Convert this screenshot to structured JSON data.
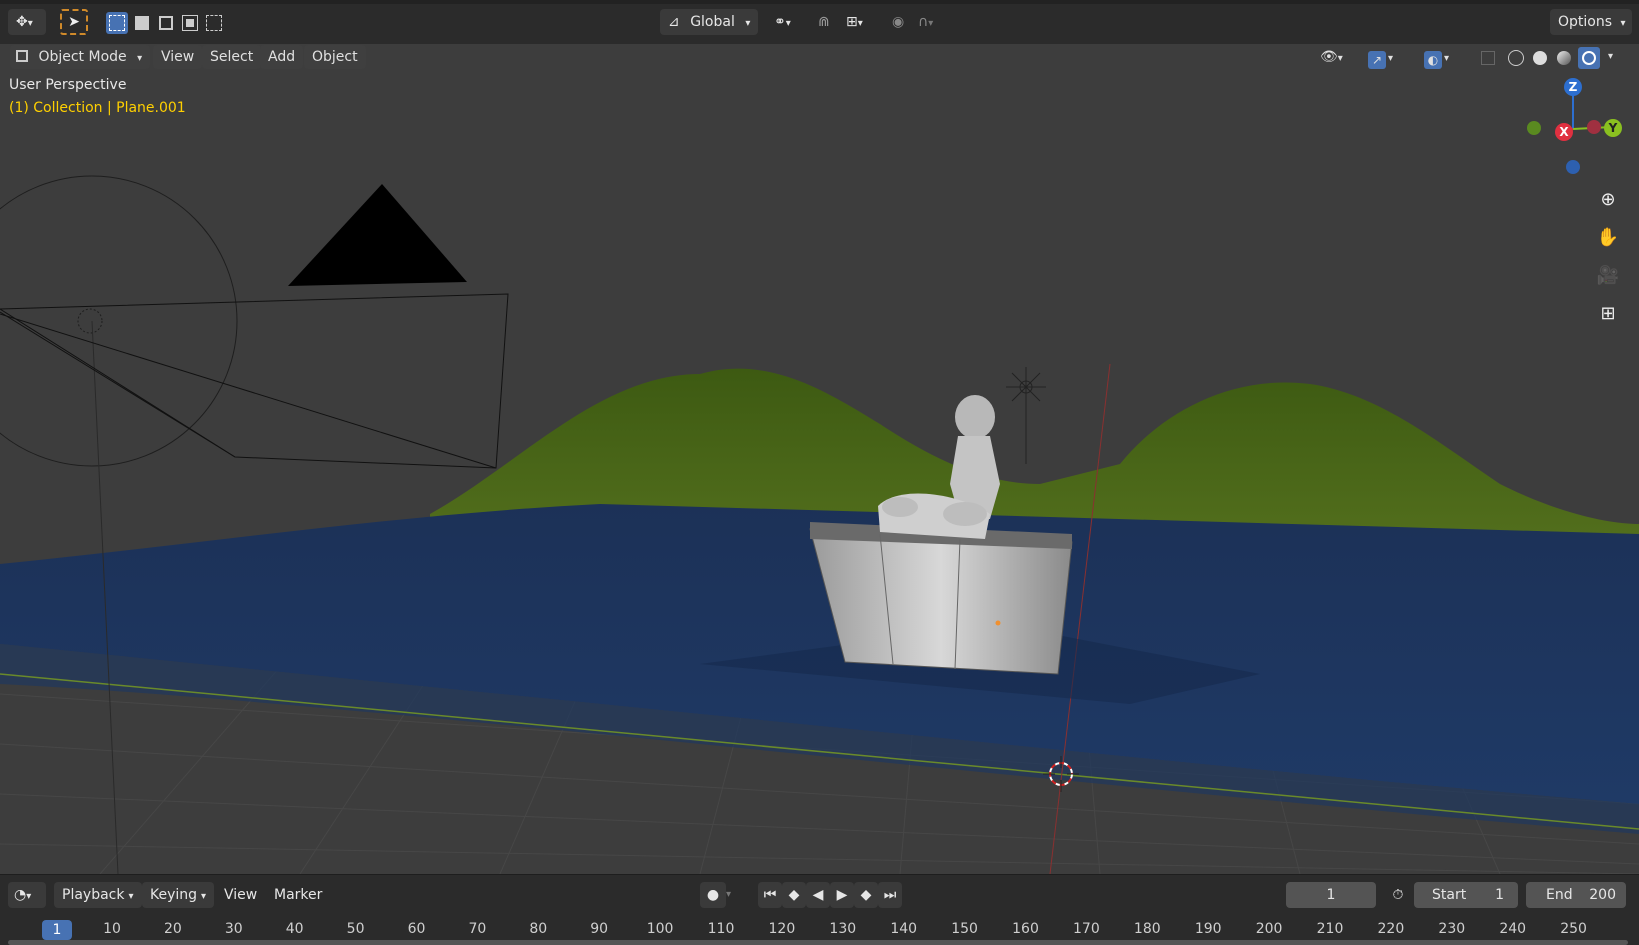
{
  "top_toolbar": {
    "orientation_label": "Global",
    "options_label": "Options"
  },
  "header": {
    "mode_label": "Object Mode",
    "menus": [
      "View",
      "Select",
      "Add",
      "Object"
    ]
  },
  "viewport": {
    "view_name": "User Perspective",
    "collection_info": "(1) Collection | Plane.001",
    "gizmo": {
      "z": "Z",
      "x": "X",
      "y": "Y"
    }
  },
  "timeline": {
    "menus": [
      "Playback",
      "Keying",
      "View",
      "Marker"
    ],
    "current_frame": "1",
    "start_label": "Start",
    "start_value": "1",
    "end_label": "End",
    "end_value": "200",
    "ruler": [
      "10",
      "20",
      "30",
      "40",
      "50",
      "60",
      "70",
      "80",
      "90",
      "100",
      "110",
      "120",
      "130",
      "140",
      "150",
      "160",
      "170",
      "180",
      "190",
      "200",
      "210",
      "220",
      "230",
      "240",
      "250"
    ],
    "playhead_label": "1"
  },
  "colors": {
    "accent_blue": "#4772b3",
    "info_yellow": "#ffd000",
    "water": "#1e3358",
    "hills": "#4a6518"
  }
}
